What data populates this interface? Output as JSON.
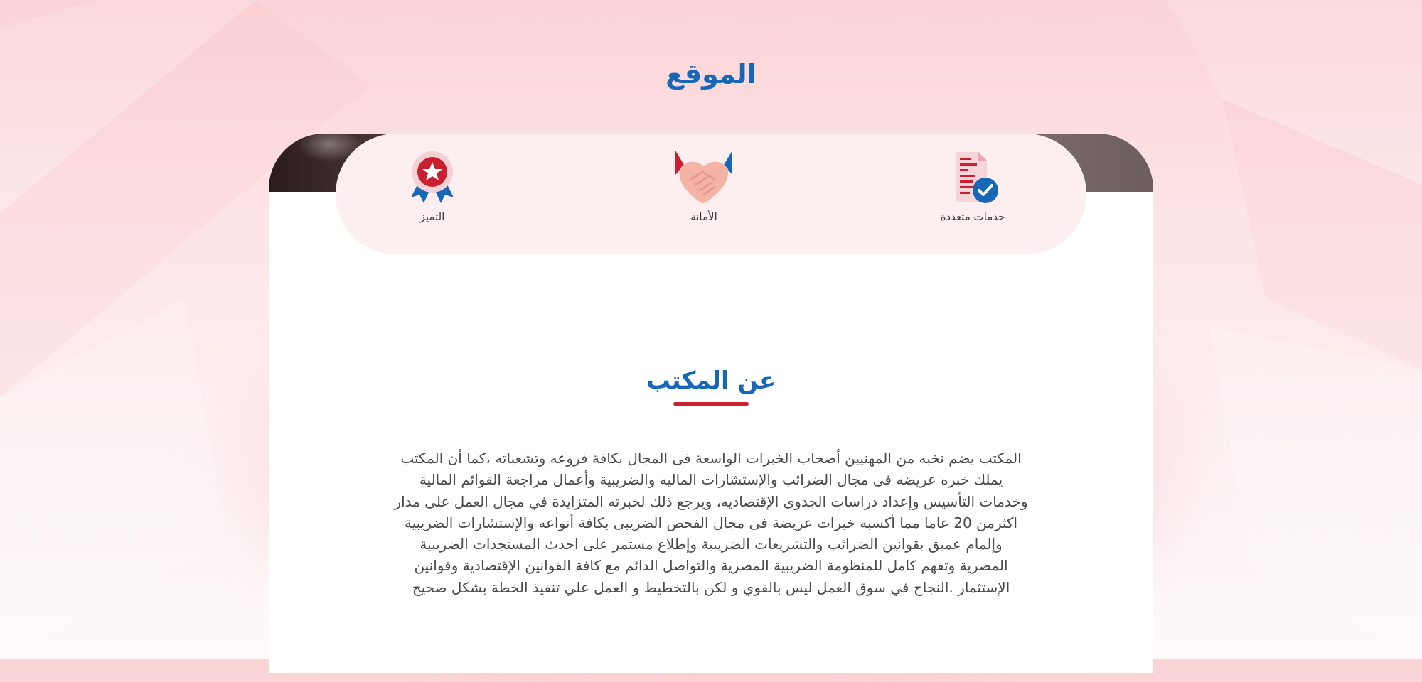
{
  "page": {
    "title": "الموقع"
  },
  "features": [
    {
      "icon": "award-ribbon-icon",
      "label": "التميز"
    },
    {
      "icon": "handshake-icon",
      "label": "الأمانة"
    },
    {
      "icon": "document-check-icon",
      "label": "خدمات متعددة"
    }
  ],
  "about": {
    "title": "عن المكتب",
    "lines": [
      "المكتب يضم نخبه من المهنيين أصحاب الخبرات الواسعة فى المجال بكافة فروعه وتشعباته ،كما أن المكتب",
      "يملك خبره عريضه فى مجال الضرائب والإستشارات الماليه والضريبية وأعمال مراجعة القوائم المالية",
      "وخدمات التأسيس وإعداد دراسات الجدوى الإقتصاديه، ويرجع ذلك لخبرته المتزايدة في مجال العمل على مدار",
      "اكثرمن 20 عاما مما أكسبه خبرات عريضة فى مجال الفحص الضريبى بكافة أنواعه والإستشارات الضريبية",
      "وإلمام عميق بقوانين الضرائب والتشريعات الضريبية وإطلاع مستمر على احدث المستجدات الضريبية",
      "المصرية وتفهم كامل للمنظومة الضريبية المصرية والتواصل الدائم مع كافة القوانين الإقتصادية وقوانين",
      "الإستثمار .النجاح في سوق العمل ليس بالقوي و لكن بالتخطيط و العمل علي تنفيذ الخطة بشكل صحيح"
    ]
  },
  "colors": {
    "primary_blue": "#1767b8",
    "accent_red": "#c8202f",
    "pill_bg": "#fdeef0"
  }
}
